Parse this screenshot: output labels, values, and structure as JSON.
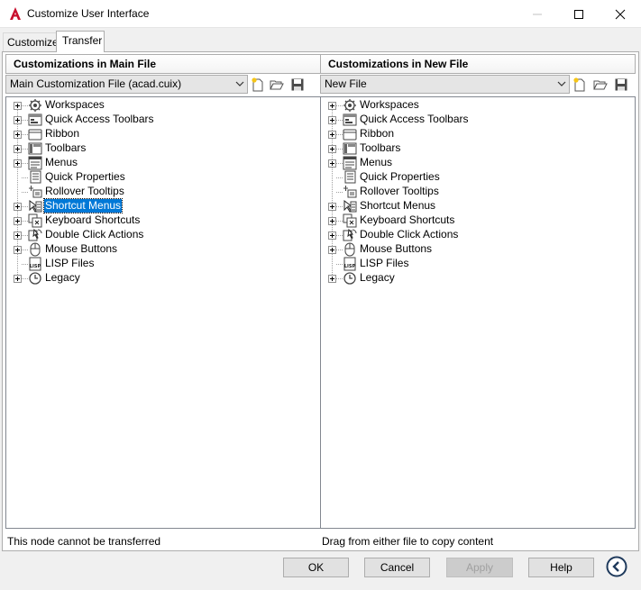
{
  "window": {
    "title": "Customize User Interface"
  },
  "tabs": [
    {
      "label": "Customize",
      "active": false
    },
    {
      "label": "Transfer",
      "active": true
    }
  ],
  "left_pane": {
    "header": "Customizations in Main File",
    "file_selected": "Main Customization File (acad.cuix)",
    "status": "This node cannot be transferred",
    "selected_item": "Shortcut Menus"
  },
  "right_pane": {
    "header": "Customizations in New File",
    "file_selected": "New File",
    "status": "Drag from either file to copy content"
  },
  "tree_items": [
    {
      "label": "Workspaces",
      "icon": "workspaces-icon",
      "expandable": true
    },
    {
      "label": "Quick Access Toolbars",
      "icon": "quick-access-toolbars-icon",
      "expandable": true
    },
    {
      "label": "Ribbon",
      "icon": "ribbon-icon",
      "expandable": true
    },
    {
      "label": "Toolbars",
      "icon": "toolbars-icon",
      "expandable": true
    },
    {
      "label": "Menus",
      "icon": "menus-icon",
      "expandable": true
    },
    {
      "label": "Quick Properties",
      "icon": "quick-properties-icon",
      "expandable": false
    },
    {
      "label": "Rollover Tooltips",
      "icon": "rollover-tooltips-icon",
      "expandable": false
    },
    {
      "label": "Shortcut Menus",
      "icon": "shortcut-menus-icon",
      "expandable": true
    },
    {
      "label": "Keyboard Shortcuts",
      "icon": "keyboard-shortcuts-icon",
      "expandable": true
    },
    {
      "label": "Double Click Actions",
      "icon": "double-click-actions-icon",
      "expandable": true
    },
    {
      "label": "Mouse Buttons",
      "icon": "mouse-buttons-icon",
      "expandable": true
    },
    {
      "label": "LISP Files",
      "icon": "lisp-files-icon",
      "expandable": false
    },
    {
      "label": "Legacy",
      "icon": "legacy-icon",
      "expandable": true
    }
  ],
  "buttons": {
    "ok": "OK",
    "cancel": "Cancel",
    "apply": "Apply",
    "help": "Help"
  },
  "colors": {
    "selection": "#0078d7",
    "app_logo": "#c8102e"
  }
}
